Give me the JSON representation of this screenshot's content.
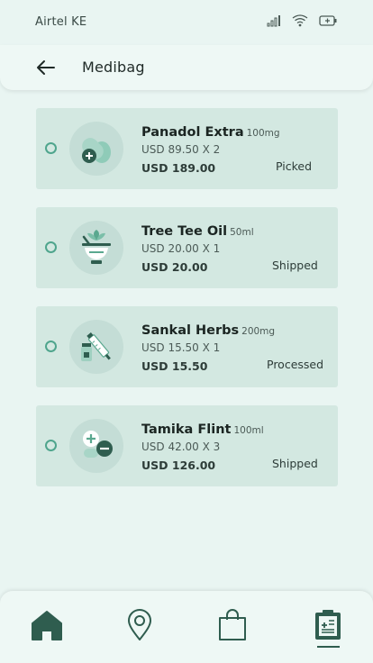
{
  "status_bar": {
    "carrier": "Airtel KE",
    "icons": [
      "signal-icon",
      "wifi-icon",
      "battery-icon"
    ]
  },
  "header": {
    "title": "Medibag",
    "back_icon": "arrow-left-icon"
  },
  "items": [
    {
      "name": "Panadol Extra",
      "quantity": "100mg",
      "price": "USD 89.50 X 2",
      "total": "USD 189.00",
      "status": "Picked",
      "icon": "pills-icon"
    },
    {
      "name": "Tree Tee Oil",
      "quantity": "50ml",
      "price": "USD 20.00 X 1",
      "total": "USD 20.00",
      "status": "Shipped",
      "icon": "herbal-mortar-icon"
    },
    {
      "name": "Sankal Herbs",
      "quantity": "200mg",
      "price": "USD 15.50 X 1",
      "total": "USD 15.50",
      "status": "Processed",
      "icon": "medicine-syringe-icon"
    },
    {
      "name": "Tamika Flint",
      "quantity": "100ml",
      "price": "USD 42.00 X 3",
      "total": "USD 126.00",
      "status": "Shipped",
      "icon": "plus-minus-capsule-icon"
    }
  ],
  "nav": {
    "items": [
      "home-icon",
      "location-pin-icon",
      "shopping-bag-icon",
      "clipboard-icon"
    ],
    "active": "clipboard-icon"
  },
  "colors": {
    "background": "#e9f5f2",
    "card": "#d3e8e1",
    "accent": "#4fa58d",
    "dark": "#2f5d4f"
  }
}
